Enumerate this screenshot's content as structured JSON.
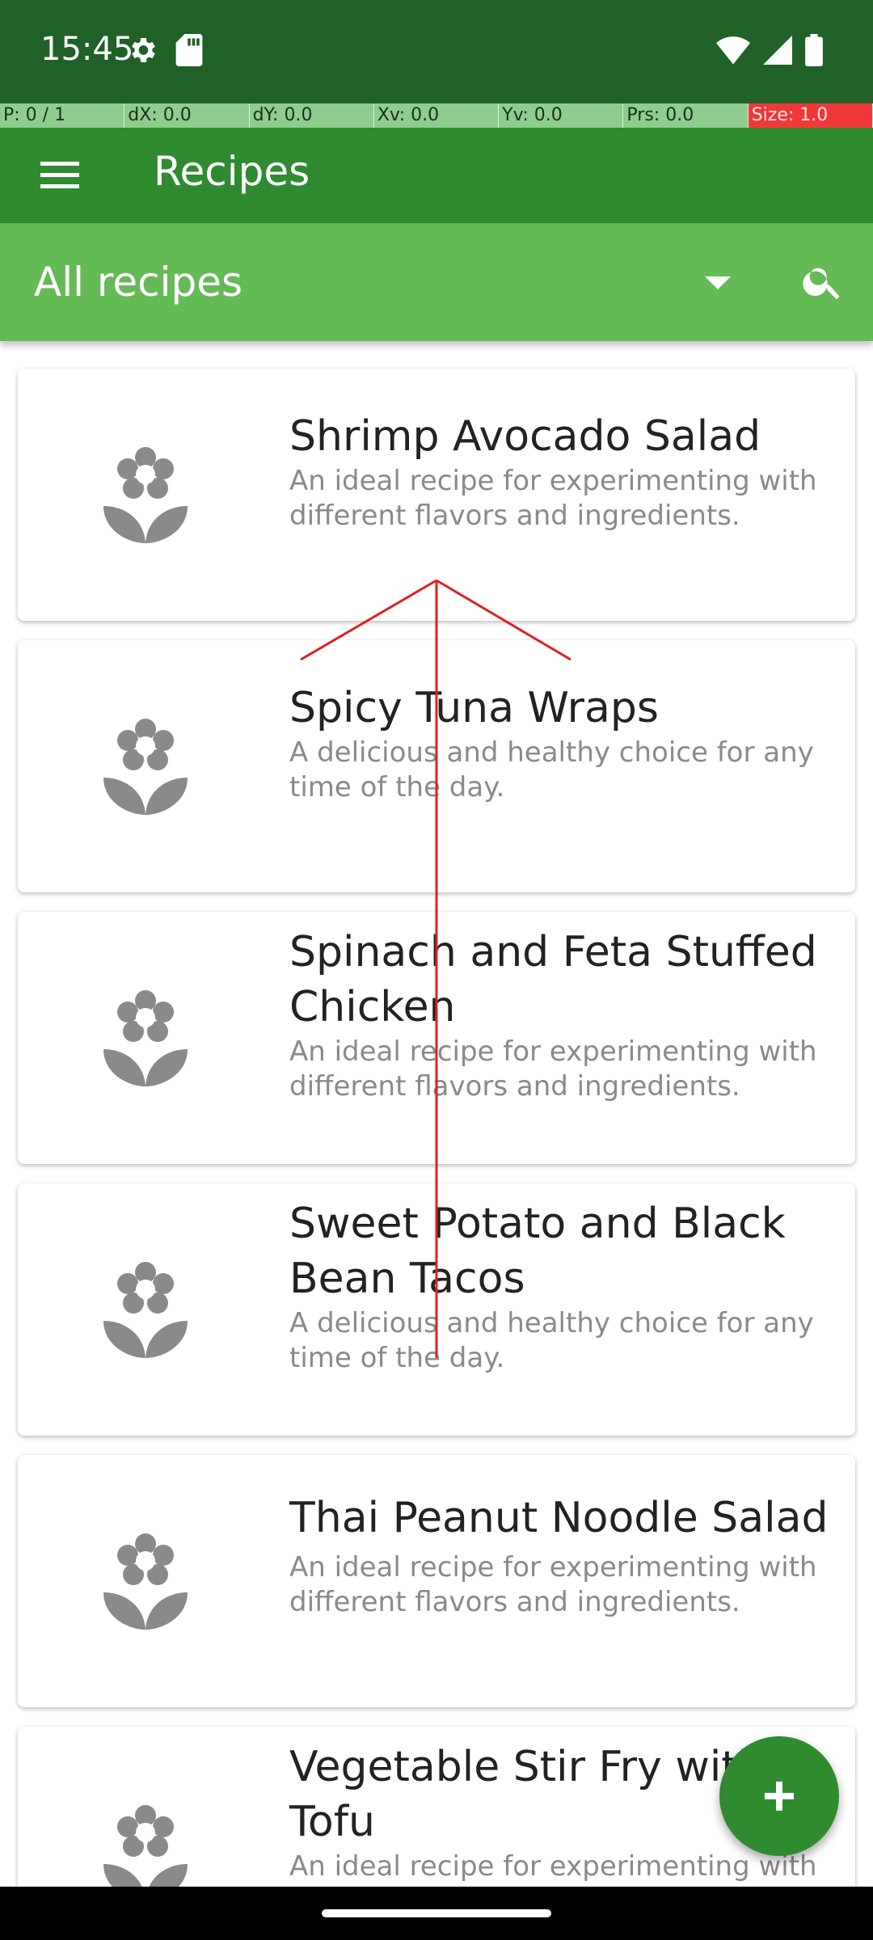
{
  "status_bar": {
    "time": "15:45",
    "icons": [
      "settings-gear-icon",
      "sd-card-icon",
      "wifi-icon",
      "signal-icon",
      "battery-icon"
    ]
  },
  "debug_bar": {
    "cells": [
      "P: 0 / 1",
      "dX: 0.0",
      "dY: 0.0",
      "Xv: 0.0",
      "Yv: 0.0",
      "Prs: 0.0",
      "Size: 1.0"
    ]
  },
  "app_bar": {
    "title": "Recipes",
    "menu_icon": "hamburger-menu-icon"
  },
  "filter": {
    "selected": "All recipes",
    "dropdown_icon": "dropdown-arrow-icon",
    "search_icon": "search-icon"
  },
  "recipes": [
    {
      "title": "Shrimp Avocado Salad",
      "description": "An ideal recipe for experimenting with different flavors and ingredients."
    },
    {
      "title": "Spicy Tuna Wraps",
      "description": "A delicious and healthy choice for any time of the day."
    },
    {
      "title": "Spinach and Feta Stuffed Chicken",
      "description": "An ideal recipe for experimenting with different flavors and ingredients."
    },
    {
      "title": "Sweet Potato and Black Bean Tacos",
      "description": "A delicious and healthy choice for any time of the day."
    },
    {
      "title": "Thai Peanut Noodle Salad",
      "description": "An ideal recipe for experimenting with different flavors and ingredients."
    },
    {
      "title": "Vegetable Stir Fry with Tofu",
      "description": "An ideal recipe for experimenting with different flavors and ingredients."
    }
  ],
  "fab": {
    "icon": "plus-icon"
  },
  "colors": {
    "status_bar": "#1f6126",
    "app_bar": "#2f8a30",
    "filter_bar": "#64ba54",
    "recipe_icon": "#8a8a8a",
    "gesture_line": "#e02020"
  }
}
